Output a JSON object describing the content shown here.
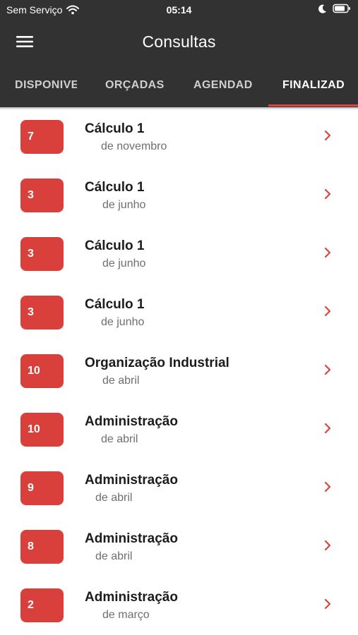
{
  "status": {
    "carrier": "Sem Serviço",
    "time": "05:14"
  },
  "header": {
    "title": "Consultas"
  },
  "tabs": [
    {
      "label": "DISPONIVE",
      "active": false
    },
    {
      "label": "ORÇADAS",
      "active": false
    },
    {
      "label": "AGENDADA",
      "active": false
    },
    {
      "label": "FINALIZAD",
      "active": true
    }
  ],
  "colors": {
    "bar": "#323232",
    "accent": "#d9403b",
    "chevron": "#d9463f"
  },
  "items": [
    {
      "badge": "7",
      "title": "Cálculo 1",
      "subtitle": "de novembro"
    },
    {
      "badge": "3",
      "title": "Cálculo 1",
      "subtitle": "de junho"
    },
    {
      "badge": "3",
      "title": "Cálculo 1",
      "subtitle": "de junho"
    },
    {
      "badge": "3",
      "title": "Cálculo 1",
      "subtitle": "de junho"
    },
    {
      "badge": "10",
      "title": "Organização Industrial",
      "subtitle": "de abril"
    },
    {
      "badge": "10",
      "title": "Administração",
      "subtitle": "de abril"
    },
    {
      "badge": "9",
      "title": "Administração",
      "subtitle": "de abril"
    },
    {
      "badge": "8",
      "title": "Administração",
      "subtitle": "de abril"
    },
    {
      "badge": "2",
      "title": "Administração",
      "subtitle": "de março"
    }
  ]
}
